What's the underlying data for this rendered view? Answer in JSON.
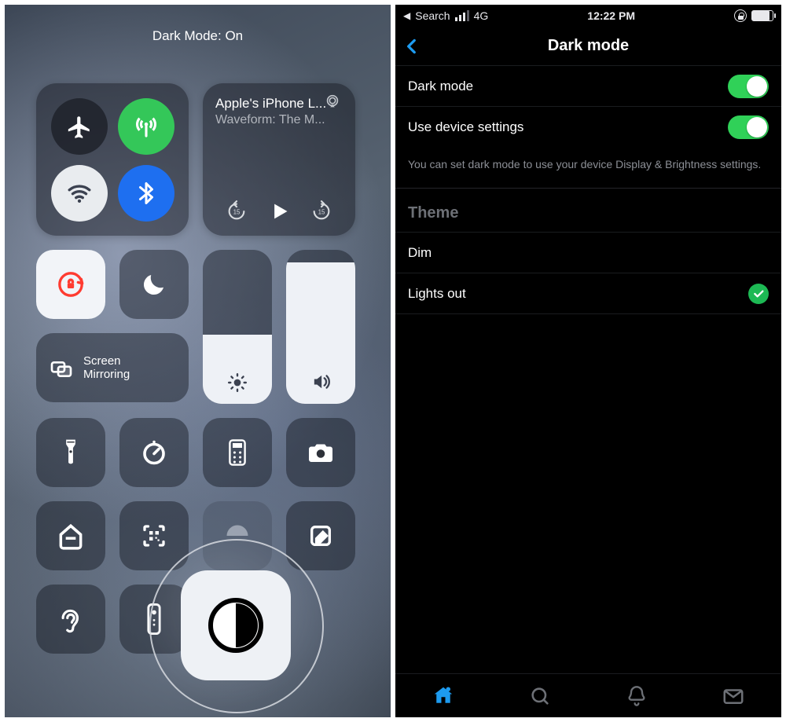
{
  "control_center": {
    "header": "Dark Mode: On",
    "media": {
      "title": "Apple's iPhone L...",
      "subtitle": "Waveform: The M..."
    },
    "screen_mirroring_label": "Screen\nMirroring",
    "brightness_percent": 45,
    "volume_percent": 92
  },
  "settings": {
    "statusbar": {
      "back_app": "Search",
      "network": "4G",
      "time": "12:22 PM"
    },
    "nav_title": "Dark mode",
    "dark_mode": {
      "label": "Dark mode",
      "on": true
    },
    "use_device": {
      "label": "Use device settings",
      "on": true,
      "note": "You can set dark mode to use your device Display & Brightness settings."
    },
    "theme": {
      "header": "Theme",
      "options": [
        {
          "label": "Dim",
          "selected": false
        },
        {
          "label": "Lights out",
          "selected": true
        }
      ]
    }
  }
}
